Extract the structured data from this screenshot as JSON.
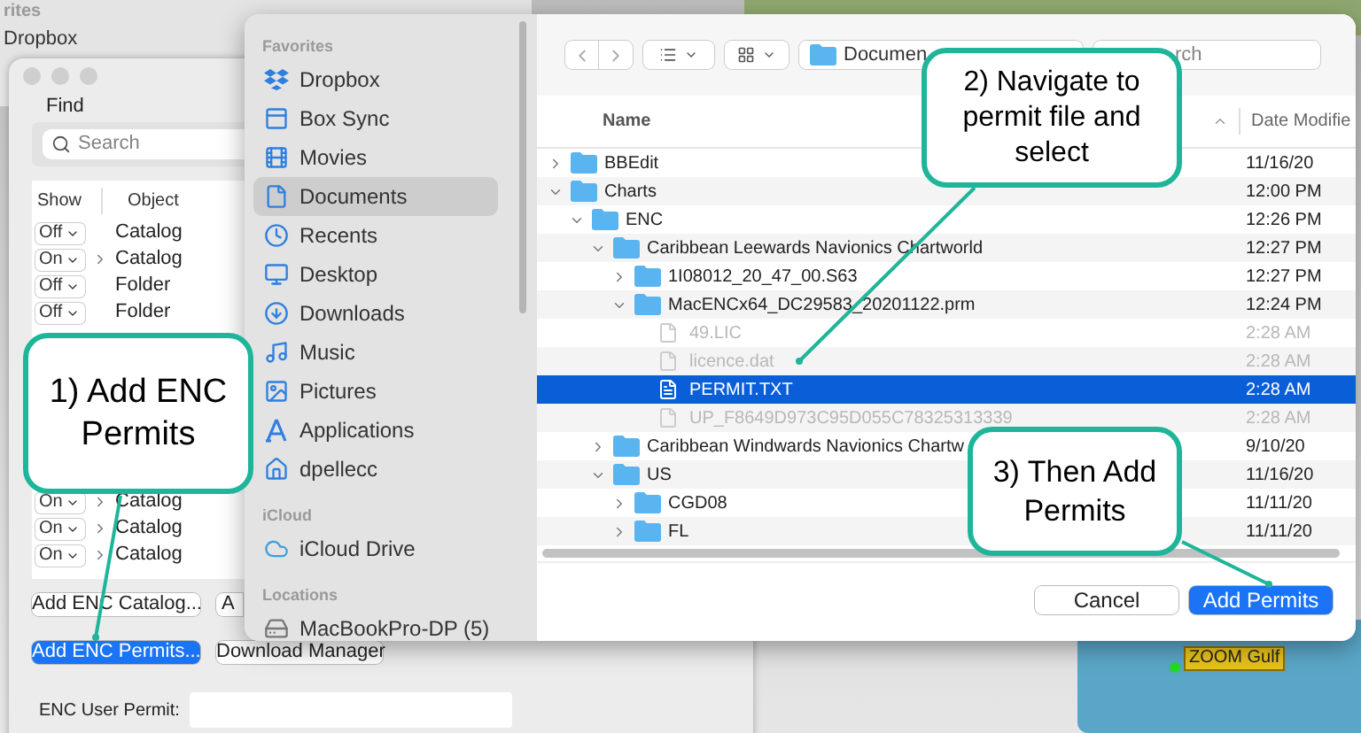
{
  "back_window": {
    "sidebar_header": "rites",
    "sidebar_item": "Dropbox"
  },
  "find_window": {
    "find_label": "Find",
    "search": {
      "placeholder": "Search"
    },
    "columns": [
      "Show",
      "Object"
    ],
    "rows": [
      {
        "show": "Off",
        "expandable": false,
        "object": "Catalog"
      },
      {
        "show": "On",
        "expandable": true,
        "object": "Catalog"
      },
      {
        "show": "Off",
        "expandable": false,
        "object": "Folder"
      },
      {
        "show": "Off",
        "expandable": false,
        "object": "Folder"
      },
      {
        "show": "On",
        "expandable": true,
        "object": "Catalog"
      },
      {
        "show": "On",
        "expandable": true,
        "object": "Catalog"
      },
      {
        "show": "On",
        "expandable": true,
        "object": "Catalog"
      }
    ],
    "buttons": [
      {
        "label": "Add ENC Catalog...",
        "primary": false
      },
      {
        "label": "A",
        "primary": false
      },
      {
        "label": "Add ENC Permits...",
        "primary": true
      },
      {
        "label": "Download Manager",
        "primary": false
      }
    ],
    "permit_label": "ENC User Permit:"
  },
  "open_dialog": {
    "sidebar": [
      {
        "header": "Favorites",
        "items": [
          {
            "label": "Dropbox",
            "selected": false
          },
          {
            "label": "Box Sync",
            "selected": false
          },
          {
            "label": "Movies",
            "selected": false
          },
          {
            "label": "Documents",
            "selected": true
          },
          {
            "label": "Recents",
            "selected": false
          },
          {
            "label": "Desktop",
            "selected": false
          },
          {
            "label": "Downloads",
            "selected": false
          },
          {
            "label": "Music",
            "selected": false
          },
          {
            "label": "Pictures",
            "selected": false
          },
          {
            "label": "Applications",
            "selected": false
          },
          {
            "label": "dpellecc",
            "selected": false
          }
        ]
      },
      {
        "header": "iCloud",
        "items": [
          {
            "label": "iCloud Drive",
            "selected": false
          }
        ]
      },
      {
        "header": "Locations",
        "items": [
          {
            "label": "MacBookPro-DP (5)",
            "selected": false
          }
        ]
      }
    ],
    "location": "Documen",
    "search": {
      "placeholder": "rch"
    },
    "columns": [
      "Name",
      "Date Modifie"
    ],
    "tree": [
      {
        "kind": "folder",
        "name": "BBEdit",
        "date": "11/16/20",
        "expanded": false,
        "selected": false
      },
      {
        "kind": "folder",
        "name": "Charts",
        "date": "12:00 PM",
        "expanded": true,
        "selected": false,
        "children": [
          {
            "kind": "folder",
            "name": "ENC",
            "date": "12:26 PM",
            "expanded": true,
            "selected": false,
            "children": [
              {
                "kind": "folder",
                "name": "Caribbean Leewards Navionics Chartworld",
                "date": "12:27 PM",
                "expanded": true,
                "selected": false,
                "children": [
                  {
                    "kind": "folder",
                    "name": "1I08012_20_47_00.S63",
                    "date": "12:27 PM",
                    "expanded": false,
                    "selected": false
                  },
                  {
                    "kind": "folder",
                    "name": "MacENCx64_DC29583_20201122.prm",
                    "date": "12:24 PM",
                    "expanded": true,
                    "selected": false,
                    "children": [
                      {
                        "kind": "file",
                        "name": "49.LIC",
                        "date": "2:28 AM",
                        "disabled": true,
                        "selected": false
                      },
                      {
                        "kind": "file",
                        "name": "licence.dat",
                        "date": "2:28 AM",
                        "disabled": true,
                        "selected": false
                      },
                      {
                        "kind": "file",
                        "name": "PERMIT.TXT",
                        "date": "2:28 AM",
                        "disabled": false,
                        "selected": true
                      },
                      {
                        "kind": "file",
                        "name": "UP_F8649D973C95D055C78325313339",
                        "date": "2:28 AM",
                        "disabled": true,
                        "selected": false
                      }
                    ]
                  }
                ]
              },
              {
                "kind": "folder",
                "name": "Caribbean Windwards Navionics Chartw",
                "date": "9/10/20",
                "expanded": false,
                "selected": false
              },
              {
                "kind": "folder",
                "name": "US",
                "date": "11/16/20",
                "expanded": true,
                "selected": false,
                "children": [
                  {
                    "kind": "folder",
                    "name": "CGD08",
                    "date": "11/11/20",
                    "expanded": false,
                    "selected": false
                  },
                  {
                    "kind": "folder",
                    "name": "FL",
                    "date": "11/11/20",
                    "expanded": false,
                    "selected": false
                  }
                ]
              }
            ]
          }
        ]
      }
    ],
    "buttons": [
      {
        "label": "Cancel",
        "primary": false
      },
      {
        "label": "Add Permits",
        "primary": true
      }
    ]
  },
  "map_label": "ZOOM Gulf",
  "callouts": [
    "1) Add ENC Permits",
    "2) Navigate to permit file and select",
    "3) Then Add Permits"
  ]
}
